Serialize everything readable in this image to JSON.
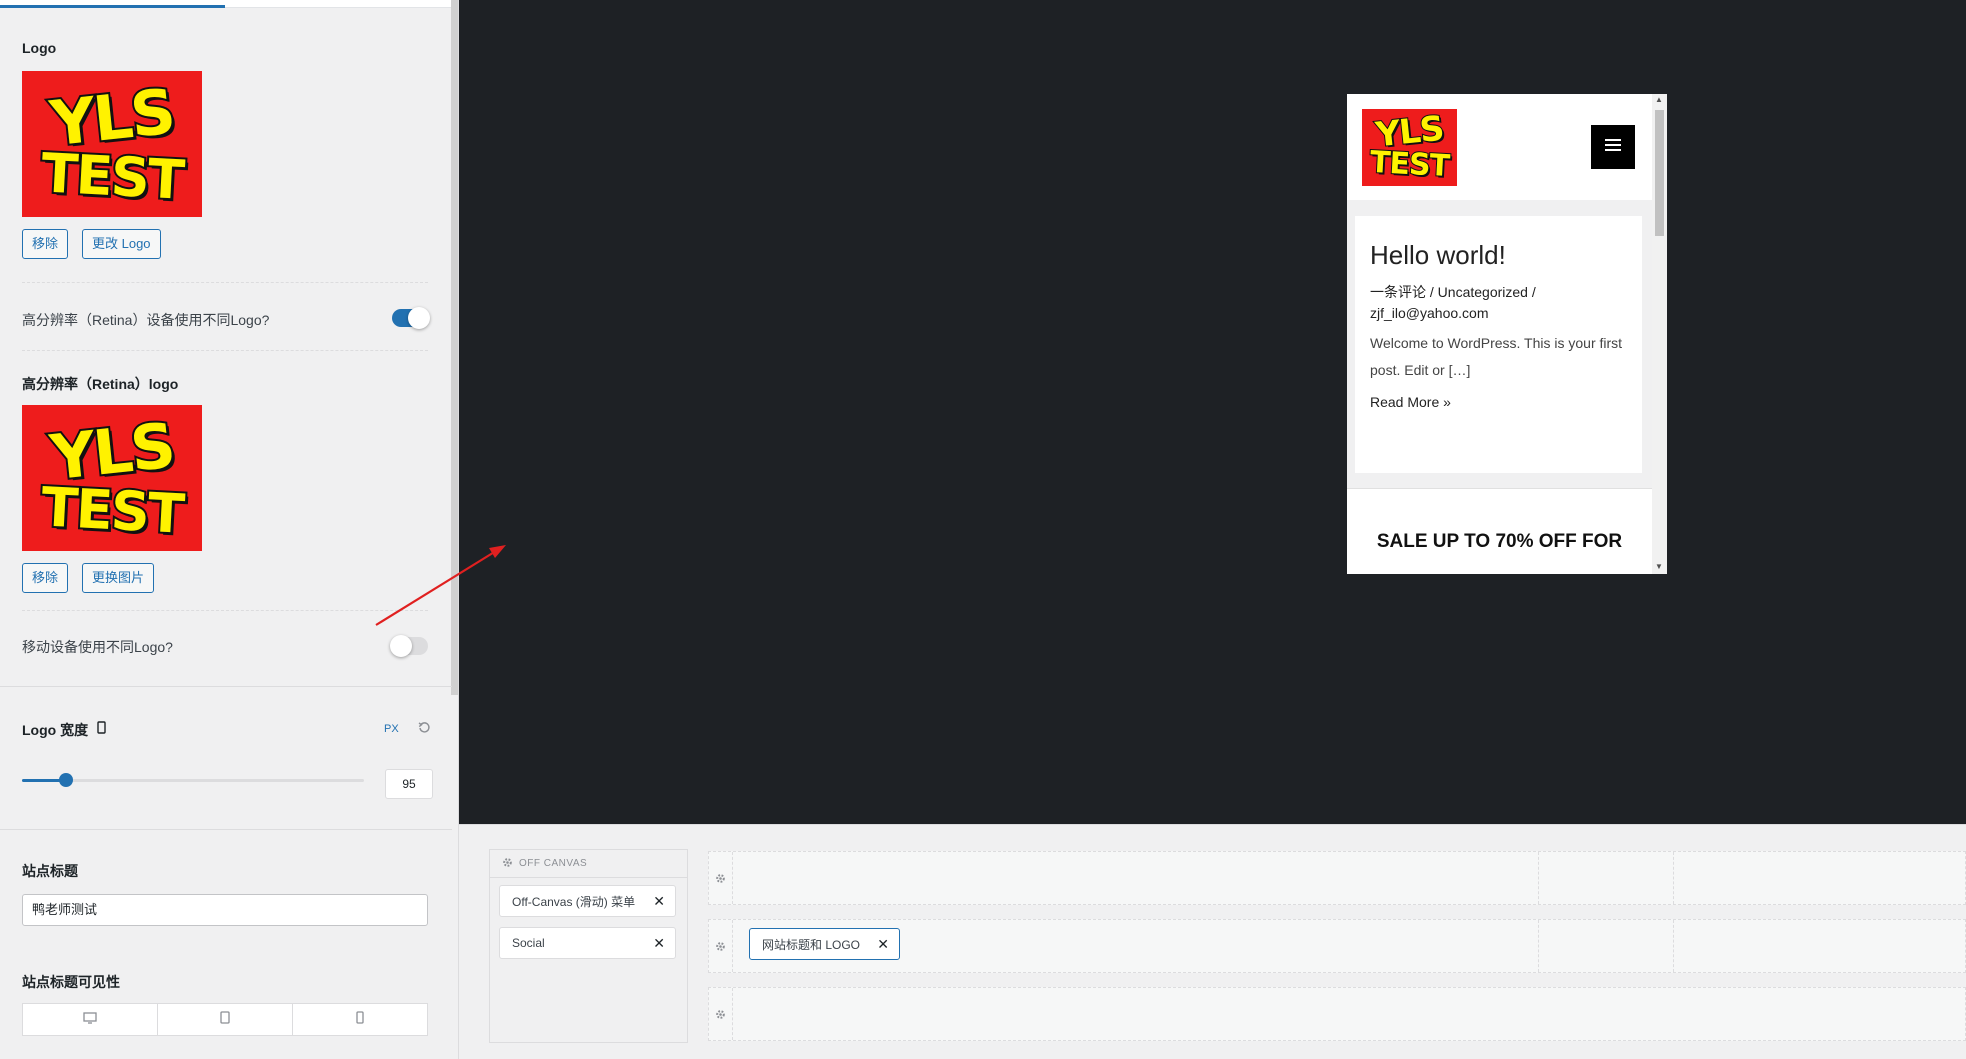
{
  "sidebar": {
    "logo_section_title": "Logo",
    "logo_remove_button": "移除",
    "logo_change_button": "更改 Logo",
    "logo_image_text": [
      "YLS",
      "TEST"
    ],
    "retina_toggle_label": "高分辨率（Retina）设备使用不同Logo?",
    "retina_toggle_on": true,
    "retina_logo_title": "高分辨率（Retina）logo",
    "retina_remove_button": "移除",
    "retina_replace_button": "更换图片",
    "mobile_toggle_label": "移动设备使用不同Logo?",
    "mobile_toggle_on": false,
    "logo_width_title": "Logo 宽度",
    "logo_width_unit": "PX",
    "logo_width_value": "95",
    "logo_width_fraction": 0.13,
    "site_title_heading": "站点标题",
    "site_title_value": "鸭老师测试",
    "site_title_visibility_heading": "站点标题可见性"
  },
  "preview": {
    "logo_text": [
      "YLS",
      "TEST"
    ],
    "post_title": "Hello world!",
    "post_meta": "一条评论 / Uncategorized / zjf_ilo@yahoo.com",
    "post_excerpt": "Welcome to WordPress. This is your first post. Edit or […]",
    "read_more": "Read More »",
    "sale_text": "SALE UP TO 70% OFF FOR"
  },
  "builder": {
    "off_canvas_heading": "OFF CANVAS",
    "off_canvas_menu_chip": "Off-Canvas (滑动) 菜单",
    "social_chip": "Social",
    "site_title_logo_chip": "网站标题和 LOGO"
  },
  "colors": {
    "accent": "#2271b1",
    "preview_bg": "#1e2125",
    "logo_red": "#ee1c1c",
    "logo_yellow": "#fff200",
    "arrow_red": "#e02020"
  }
}
